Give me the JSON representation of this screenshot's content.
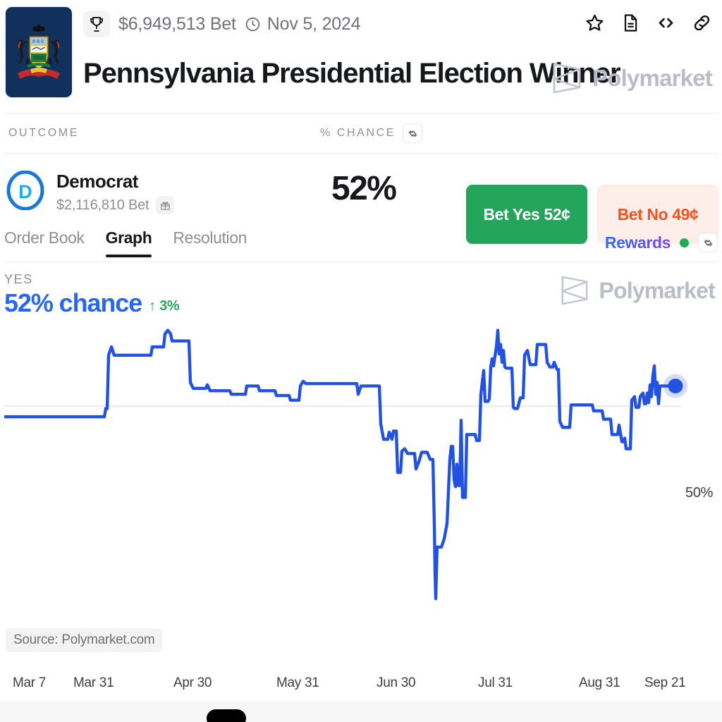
{
  "header": {
    "volume_label": "$6,949,513 Bet",
    "date_label": "Nov 5, 2024",
    "title": "Pennsylvania Presidential Election Winner",
    "brand": "Polymarket",
    "icons": [
      "star-icon",
      "document-icon",
      "code-icon",
      "link-icon"
    ],
    "flag_alt": "Pennsylvania state flag"
  },
  "table_header": {
    "outcome": "OUTCOME",
    "chance": "% CHANCE"
  },
  "outcome": {
    "name": "Democrat",
    "avatar_letter": "D",
    "volume": "$2,116,810 Bet",
    "percent": "52%",
    "bet_yes": "Bet Yes 52¢",
    "bet_no": "Bet No 49¢",
    "yes_color": "#25a55c",
    "no_color": "#f4521d"
  },
  "tabs": [
    {
      "label": "Order Book",
      "active": false
    },
    {
      "label": "Graph",
      "active": true
    },
    {
      "label": "Resolution",
      "active": false
    }
  ],
  "rewards": {
    "label": "Rewards",
    "status_color": "#22ab55"
  },
  "chart_header": {
    "side_label": "YES",
    "chance": "52% chance",
    "delta": "↑ 3%",
    "brand": "Polymarket"
  },
  "chart_footer": {
    "source": "Source: Polymarket.com"
  },
  "chart_data": {
    "type": "line",
    "title": "Pennsylvania Presidential Election Winner — Democrat (YES)",
    "subtitle": "52% chance",
    "xlabel": "",
    "ylabel": "% chance",
    "ylim": [
      15,
      65
    ],
    "grid": false,
    "legend": false,
    "line_color": "#2352e0",
    "baseline_value": 50,
    "baseline_label": "50%",
    "endpoint_value": 52,
    "endpoint_label": "50%",
    "change_from_previous": 3,
    "tick_labels": [
      "Mar 7",
      "Mar 31",
      "Apr 30",
      "May 31",
      "Jun 30",
      "Jul 31",
      "Aug 31",
      "Sep 21"
    ],
    "tick_x": [
      12,
      98,
      240,
      386,
      528,
      672,
      815,
      908
    ],
    "series": [
      {
        "name": "Democrat YES",
        "points": [
          [
            0,
            48.2
          ],
          [
            40,
            48.2
          ],
          [
            90,
            48.2
          ],
          [
            130,
            48.2
          ],
          [
            142,
            48.2
          ],
          [
            144,
            49.6
          ],
          [
            146,
            49.6
          ],
          [
            148,
            58.6
          ],
          [
            152,
            60.0
          ],
          [
            156,
            58.6
          ],
          [
            160,
            58.6
          ],
          [
            180,
            58.6
          ],
          [
            200,
            58.6
          ],
          [
            208,
            58.6
          ],
          [
            210,
            60.0
          ],
          [
            222,
            60.0
          ],
          [
            226,
            60.0
          ],
          [
            228,
            62.2
          ],
          [
            232,
            62.8
          ],
          [
            236,
            62.2
          ],
          [
            238,
            61.0
          ],
          [
            242,
            61.0
          ],
          [
            258,
            61.0
          ],
          [
            262,
            61.0
          ],
          [
            264,
            54.0
          ],
          [
            268,
            53.0
          ],
          [
            272,
            53.0
          ],
          [
            286,
            53.0
          ],
          [
            288,
            53.6
          ],
          [
            292,
            52.6
          ],
          [
            300,
            52.6
          ],
          [
            320,
            52.6
          ],
          [
            322,
            52.0
          ],
          [
            330,
            52.0
          ],
          [
            342,
            52.0
          ],
          [
            344,
            53.4
          ],
          [
            356,
            53.4
          ],
          [
            360,
            53.4
          ],
          [
            362,
            52.6
          ],
          [
            378,
            52.6
          ],
          [
            384,
            52.6
          ],
          [
            386,
            51.8
          ],
          [
            398,
            51.8
          ],
          [
            404,
            51.8
          ],
          [
            406,
            51.0
          ],
          [
            414,
            51.0
          ],
          [
            418,
            51.0
          ],
          [
            420,
            53.4
          ],
          [
            424,
            54.2
          ],
          [
            428,
            53.8
          ],
          [
            440,
            53.8
          ],
          [
            470,
            53.8
          ],
          [
            496,
            53.8
          ],
          [
            500,
            53.8
          ],
          [
            502,
            52.0
          ],
          [
            506,
            53.4
          ],
          [
            512,
            53.4
          ],
          [
            526,
            53.4
          ],
          [
            532,
            53.4
          ],
          [
            534,
            47.0
          ],
          [
            538,
            44.4
          ],
          [
            540,
            44.4
          ],
          [
            544,
            44.4
          ],
          [
            546,
            45.6
          ],
          [
            550,
            44.4
          ],
          [
            552,
            45.8
          ],
          [
            554,
            45.8
          ],
          [
            556,
            45.8
          ],
          [
            558,
            38.8
          ],
          [
            562,
            38.8
          ],
          [
            564,
            42.4
          ],
          [
            568,
            42.8
          ],
          [
            572,
            42.0
          ],
          [
            580,
            42.0
          ],
          [
            582,
            42.0
          ],
          [
            584,
            39.4
          ],
          [
            588,
            40.6
          ],
          [
            592,
            42.2
          ],
          [
            598,
            42.2
          ],
          [
            600,
            42.2
          ],
          [
            604,
            41.0
          ],
          [
            608,
            41.0
          ],
          [
            610,
            30.0
          ],
          [
            611,
            22.0
          ],
          [
            612,
            17.5
          ],
          [
            613,
            22.0
          ],
          [
            614,
            26.2
          ],
          [
            616,
            26.2
          ],
          [
            620,
            26.2
          ],
          [
            624,
            27.6
          ],
          [
            628,
            30.2
          ],
          [
            632,
            41.0
          ],
          [
            634,
            43.2
          ],
          [
            636,
            43.2
          ],
          [
            638,
            37.6
          ],
          [
            640,
            36.4
          ],
          [
            642,
            40.2
          ],
          [
            644,
            36.6
          ],
          [
            646,
            36.6
          ],
          [
            648,
            47.6
          ],
          [
            650,
            34.6
          ],
          [
            652,
            34.6
          ],
          [
            654,
            34.6
          ],
          [
            656,
            45.2
          ],
          [
            658,
            45.2
          ],
          [
            664,
            45.2
          ],
          [
            668,
            45.2
          ],
          [
            670,
            44.2
          ],
          [
            674,
            44.2
          ],
          [
            676,
            52.0
          ],
          [
            680,
            56.0
          ],
          [
            682,
            50.8
          ],
          [
            684,
            50.8
          ],
          [
            686,
            50.8
          ],
          [
            688,
            51.2
          ],
          [
            690,
            56.6
          ],
          [
            692,
            58.0
          ],
          [
            694,
            56.8
          ],
          [
            696,
            58.4
          ],
          [
            698,
            60.0
          ],
          [
            700,
            62.8
          ],
          [
            702,
            58.8
          ],
          [
            704,
            60.4
          ],
          [
            706,
            57.4
          ],
          [
            708,
            59.4
          ],
          [
            710,
            56.6
          ],
          [
            712,
            56.4
          ],
          [
            716,
            56.4
          ],
          [
            720,
            56.4
          ],
          [
            722,
            49.8
          ],
          [
            724,
            49.6
          ],
          [
            728,
            49.6
          ],
          [
            732,
            51.4
          ],
          [
            734,
            51.4
          ],
          [
            736,
            51.4
          ],
          [
            738,
            58.6
          ],
          [
            742,
            59.4
          ],
          [
            746,
            57.0
          ],
          [
            752,
            57.0
          ],
          [
            754,
            57.0
          ],
          [
            756,
            60.4
          ],
          [
            762,
            60.4
          ],
          [
            768,
            60.4
          ],
          [
            770,
            57.4
          ],
          [
            774,
            56.6
          ],
          [
            778,
            56.6
          ],
          [
            780,
            57.4
          ],
          [
            784,
            56.2
          ],
          [
            786,
            56.2
          ],
          [
            788,
            47.4
          ],
          [
            792,
            46.4
          ],
          [
            796,
            46.4
          ],
          [
            802,
            46.4
          ],
          [
            804,
            50.2
          ],
          [
            812,
            50.2
          ],
          [
            826,
            50.2
          ],
          [
            834,
            50.2
          ],
          [
            836,
            49.2
          ],
          [
            842,
            49.2
          ],
          [
            848,
            49.2
          ],
          [
            850,
            47.8
          ],
          [
            856,
            47.8
          ],
          [
            860,
            47.8
          ],
          [
            862,
            45.2
          ],
          [
            866,
            45.2
          ],
          [
            870,
            45.2
          ],
          [
            872,
            46.8
          ],
          [
            874,
            45.4
          ],
          [
            876,
            44.0
          ],
          [
            878,
            44.0
          ],
          [
            880,
            44.6
          ],
          [
            882,
            42.8
          ],
          [
            884,
            42.8
          ],
          [
            888,
            42.8
          ],
          [
            890,
            51.0
          ],
          [
            894,
            51.6
          ],
          [
            896,
            49.8
          ],
          [
            900,
            49.8
          ],
          [
            902,
            51.6
          ],
          [
            906,
            52.2
          ],
          [
            908,
            50.4
          ],
          [
            910,
            50.4
          ],
          [
            912,
            52.2
          ],
          [
            914,
            50.6
          ],
          [
            916,
            53.6
          ],
          [
            918,
            51.6
          ],
          [
            920,
            55.2
          ],
          [
            922,
            56.8
          ],
          [
            924,
            52.0
          ],
          [
            926,
            54.0
          ],
          [
            928,
            50.4
          ],
          [
            930,
            53.4
          ],
          [
            932,
            53.4
          ],
          [
            944,
            53.4
          ],
          [
            952,
            53.4
          ]
        ]
      }
    ]
  }
}
